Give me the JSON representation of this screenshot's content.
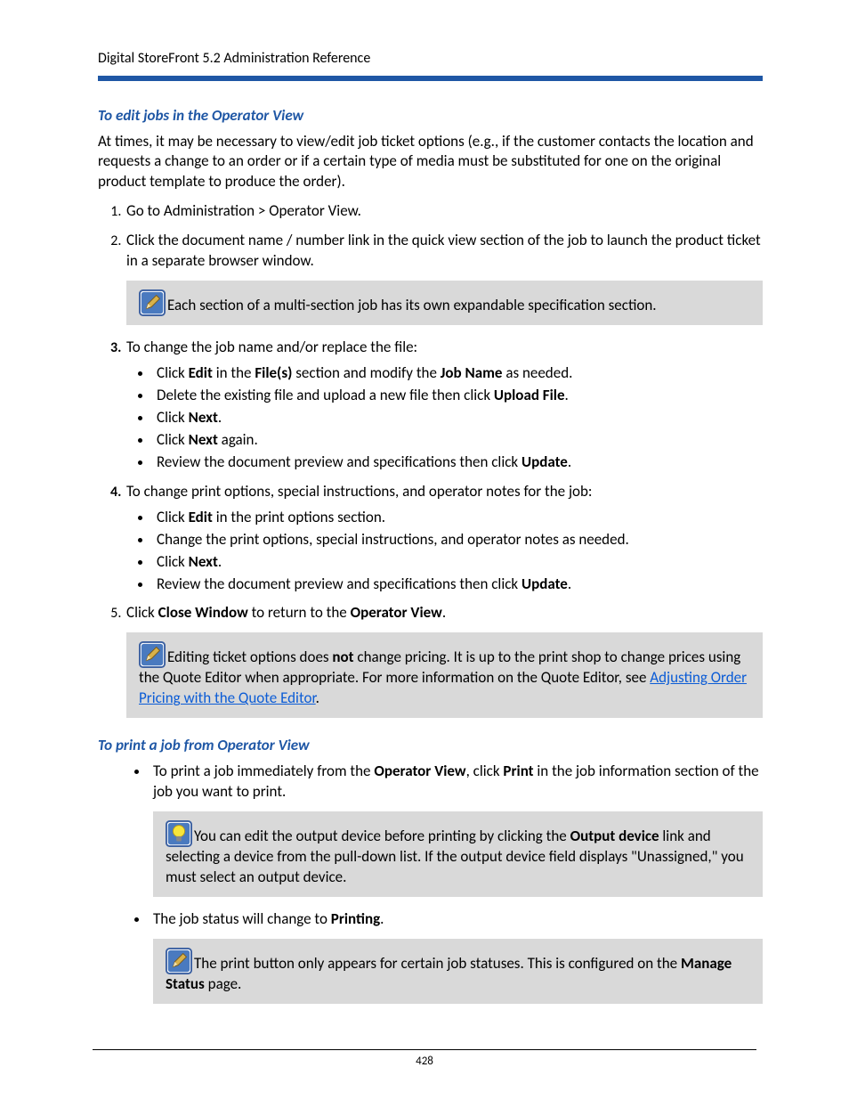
{
  "header": "Digital StoreFront 5.2 Administration Reference",
  "page_number": "428",
  "sec1": {
    "heading": "To edit jobs in the Operator View",
    "intro": "At times, it may be necessary to view/edit job ticket options (e.g., if the customer contacts the location and requests a change to an order or if a certain type of media must be substituted for one on the original product template to produce the order).",
    "step1": "Go to Administration > Operator View.",
    "step2": "Click the document name / number link in the quick view section of the job to launch the product ticket in a separate browser window.",
    "note1": "Each section of a multi-section job has its own expandable specification section.",
    "step3_lead": "To change the job name and/or replace the file:",
    "s3b1_a": "Click ",
    "s3b1_b": "Edit",
    "s3b1_c": " in the ",
    "s3b1_d": "File(s)",
    "s3b1_e": " section and modify the ",
    "s3b1_f": "Job Name",
    "s3b1_g": " as needed.",
    "s3b2_a": "Delete the existing file and upload a new file then click ",
    "s3b2_b": "Upload File",
    "s3b2_c": ".",
    "s3b3_a": "Click ",
    "s3b3_b": "Next",
    "s3b3_c": ".",
    "s3b4_a": "Click ",
    "s3b4_b": "Next",
    "s3b4_c": " again.",
    "s3b5_a": "Review the document preview and specifications then click ",
    "s3b5_b": "Update",
    "s3b5_c": ".",
    "step4_lead": "To change print options, special instructions, and operator notes for the job:",
    "s4b1_a": "Click ",
    "s4b1_b": "Edit",
    "s4b1_c": " in the print options section.",
    "s4b2": "Change the print options, special instructions, and operator notes as needed.",
    "s4b3_a": "Click ",
    "s4b3_b": "Next",
    "s4b3_c": ".",
    "s4b4_a": "Review the document preview and specifications then click ",
    "s4b4_b": "Update",
    "s4b4_c": ".",
    "step5_a": "Click ",
    "step5_b": "Close Window",
    "step5_c": " to return to the ",
    "step5_d": "Operator View",
    "step5_e": ".",
    "note2_a": "Editing ticket options does ",
    "note2_b": "not",
    "note2_c": " change pricing. It is up to the print shop to change prices using the Quote Editor when appropriate. For more information on the Quote Editor, see ",
    "note2_link": "Adjusting Order Pricing with the Quote Editor",
    "note2_d": "."
  },
  "sec2": {
    "heading": "To print a job from Operator View",
    "b1_a": "To print a job immediately from the ",
    "b1_b": "Operator View",
    "b1_c": ", click ",
    "b1_d": "Print",
    "b1_e": " in the job information section of the job you want to print.",
    "note3_a": "You can edit the output device before printing by clicking the ",
    "note3_b": "Output device",
    "note3_c": " link and selecting a device from the pull-down list. If the output device field displays \"Unassigned,\" you must select an output device.",
    "b2_a": "The job status will change to ",
    "b2_b": "Printing",
    "b2_c": ".",
    "note4_a": "The print button only appears for certain job statuses. This is configured on the ",
    "note4_b": "Manage Status",
    "note4_c": " page."
  }
}
